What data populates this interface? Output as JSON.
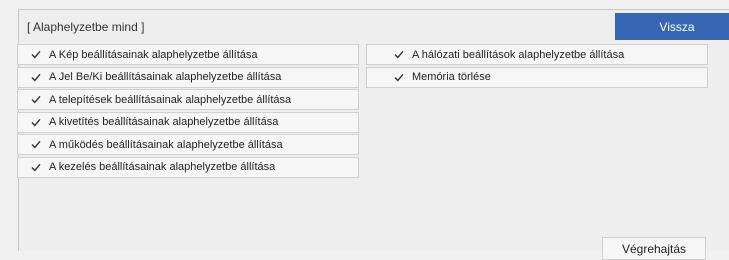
{
  "title": "[ Alaphelyzetbe mind ]",
  "back_label": "Vissza",
  "execute_label": "Végrehajtás",
  "left_items": [
    {
      "label": "A Kép beállításainak alaphelyzetbe állítása"
    },
    {
      "label": "A Jel Be/Ki beállításainak alaphelyzetbe állítása"
    },
    {
      "label": "A telepítések beállításainak alaphelyzetbe állítása"
    },
    {
      "label": "A kivetítés beállításainak alaphelyzetbe állítása"
    },
    {
      "label": "A működés beállításainak alaphelyzetbe állítása"
    },
    {
      "label": "A kezelés beállításainak alaphelyzetbe állítása"
    }
  ],
  "right_items": [
    {
      "label": "A hálózati beállítások alaphelyzetbe állítása"
    },
    {
      "label": "Memória törlése"
    }
  ],
  "colors": {
    "accent": "#3766b5",
    "background": "#eeeeee"
  },
  "icons": {
    "item_icon": "check-icon"
  }
}
